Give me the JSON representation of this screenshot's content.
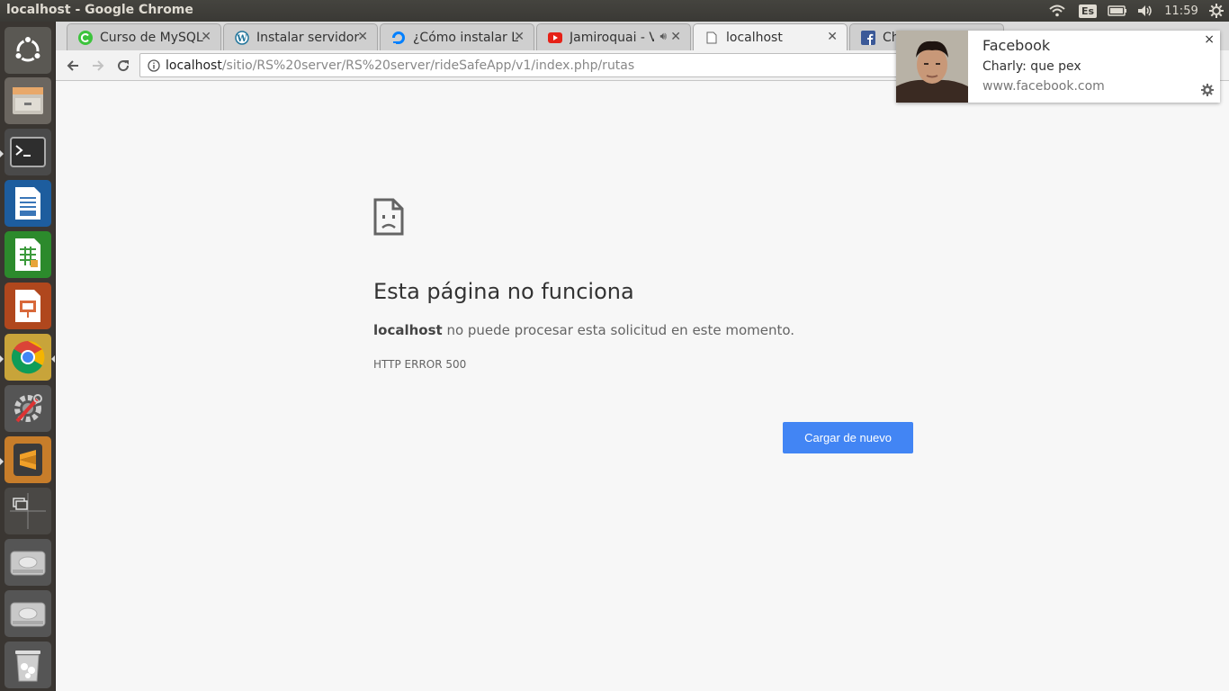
{
  "window": {
    "title": "localhost - Google Chrome"
  },
  "tray": {
    "keyboard": "Es",
    "clock": "11:59"
  },
  "tabs": [
    {
      "label": "Curso de MySQL",
      "icon": "green-c-icon"
    },
    {
      "label": "Instalar servidor",
      "icon": "wordpress-icon"
    },
    {
      "label": "¿Cómo instalar L",
      "icon": "digitalocean-icon"
    },
    {
      "label": "Jamiroquai - V",
      "icon": "youtube-icon"
    },
    {
      "label": "localhost",
      "icon": "page-icon"
    },
    {
      "label": "Ch",
      "icon": "facebook-icon"
    }
  ],
  "address": {
    "host": "localhost",
    "path": "/sitio/RS%20server/RS%20server/rideSafeApp/v1/index.php/rutas"
  },
  "error": {
    "title": "Esta página no funciona",
    "host": "localhost",
    "message": " no puede procesar esta solicitud en este momento.",
    "code": "HTTP ERROR 500",
    "reload_label": "Cargar de nuevo"
  },
  "notification": {
    "title": "Facebook",
    "body": "Charly: que pex",
    "source": "www.facebook.com",
    "close": "×"
  },
  "colors": {
    "button_blue": "#4285f4",
    "launcher_bg": "#3a3632",
    "panel_bg": "#3c3b37"
  }
}
